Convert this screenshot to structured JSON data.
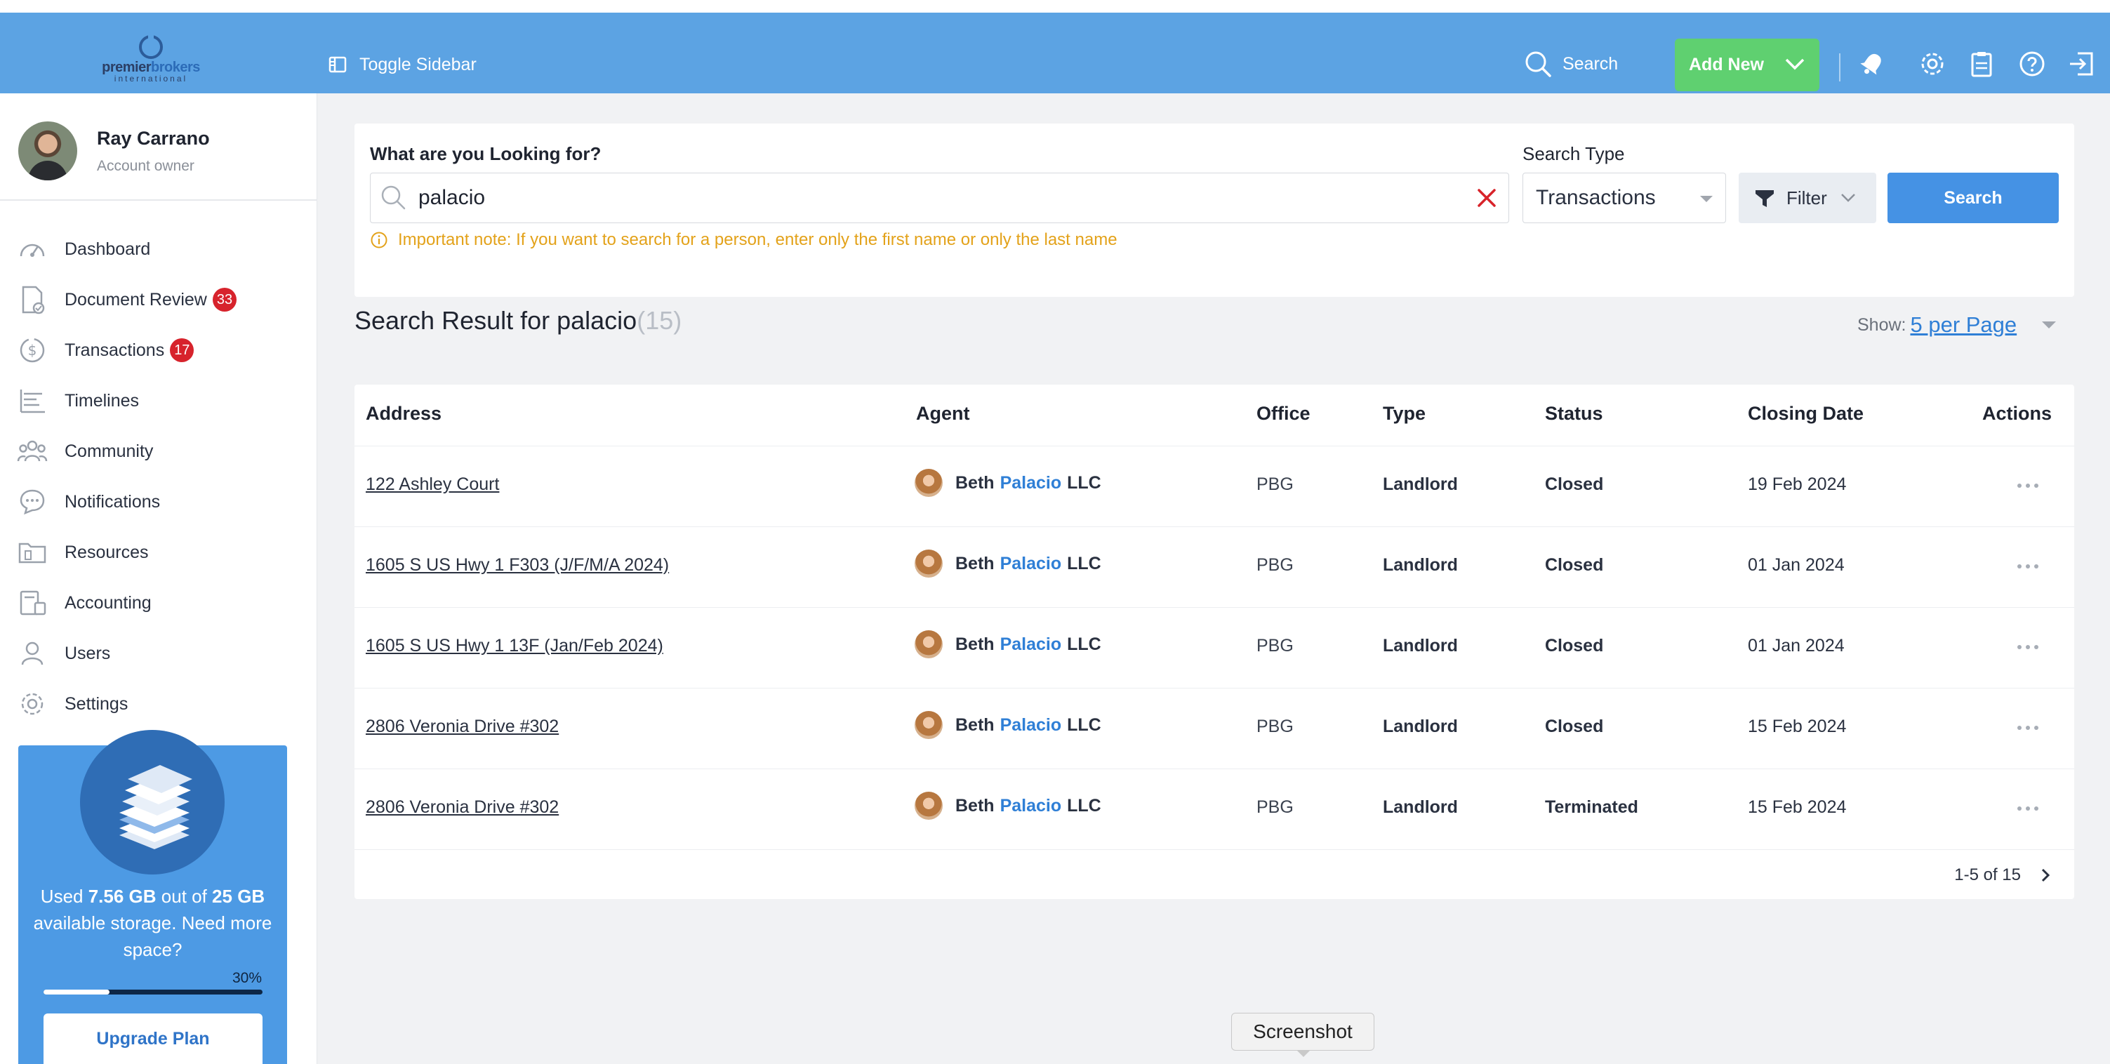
{
  "header": {
    "logo_text_a": "premier",
    "logo_text_b": "brokers",
    "logo_sub": "international",
    "toggle_label": "Toggle Sidebar",
    "search_label": "Search",
    "add_new_label": "Add New",
    "icons": [
      "bell-icon",
      "gear-icon",
      "clipboard-icon",
      "help-icon",
      "logout-icon"
    ]
  },
  "profile": {
    "name": "Ray Carrano",
    "role": "Account owner"
  },
  "sidebar": {
    "items": [
      {
        "label": "Dashboard",
        "icon": "gauge-icon"
      },
      {
        "label": "Document Review",
        "icon": "document-check-icon",
        "badge": "33"
      },
      {
        "label": "Transactions",
        "icon": "dollar-circle-icon",
        "badge": "17"
      },
      {
        "label": "Timelines",
        "icon": "timeline-icon"
      },
      {
        "label": "Community",
        "icon": "people-icon"
      },
      {
        "label": "Notifications",
        "icon": "chat-bubble-icon"
      },
      {
        "label": "Resources",
        "icon": "folder-icon"
      },
      {
        "label": "Accounting",
        "icon": "calculator-icon"
      },
      {
        "label": "Users",
        "icon": "user-icon"
      },
      {
        "label": "Settings",
        "icon": "gear-icon"
      }
    ]
  },
  "storage": {
    "used_prefix": "Used ",
    "used": "7.56 GB",
    "mid": " out of ",
    "total": "25 GB",
    "suffix": " available storage. Need more space?",
    "percent_label": "30%",
    "percent": 30,
    "upgrade_label": "Upgrade Plan"
  },
  "search": {
    "question_label": "What are you Looking for?",
    "query": "palacio",
    "type_label": "Search Type",
    "type_value": "Transactions",
    "filter_label": "Filter",
    "search_button": "Search",
    "note": "Important note: If you want to search for a person, enter only the first name or only the last name"
  },
  "results": {
    "title": "Search Result for palacio",
    "count": "(15)",
    "show_label": "Show:",
    "per_page": "5 per Page",
    "columns": [
      "Address",
      "Agent",
      "Office",
      "Type",
      "Status",
      "Closing Date",
      "Actions"
    ],
    "rows": [
      {
        "address": "122 Ashley Court",
        "agent_first": "Beth",
        "agent_match": "Palacio",
        "agent_last": "LLC",
        "office": "PBG",
        "type": "Landlord",
        "status": "Closed",
        "closing": "19 Feb 2024"
      },
      {
        "address": "1605 S US Hwy 1 F303 (J/F/M/A 2024)",
        "agent_first": "Beth",
        "agent_match": "Palacio",
        "agent_last": "LLC",
        "office": "PBG",
        "type": "Landlord",
        "status": "Closed",
        "closing": "01 Jan 2024"
      },
      {
        "address": "1605 S US Hwy 1 13F (Jan/Feb 2024)",
        "agent_first": "Beth",
        "agent_match": "Palacio",
        "agent_last": "LLC",
        "office": "PBG",
        "type": "Landlord",
        "status": "Closed",
        "closing": "01 Jan 2024"
      },
      {
        "address": "2806 Veronia Drive #302",
        "agent_first": "Beth",
        "agent_match": "Palacio",
        "agent_last": "LLC",
        "office": "PBG",
        "type": "Landlord",
        "status": "Closed",
        "closing": "15 Feb 2024"
      },
      {
        "address": "2806 Veronia Drive #302",
        "agent_first": "Beth",
        "agent_match": "Palacio",
        "agent_last": "LLC",
        "office": "PBG",
        "type": "Landlord",
        "status": "Terminated",
        "closing": "15 Feb 2024"
      }
    ],
    "pagination": "1-5 of 15"
  },
  "tooltip": "Screenshot",
  "colors": {
    "header": "#5ca3e3",
    "add_new": "#5fd070",
    "primary": "#4592e4",
    "badge": "#d7232c",
    "note": "#e3a21a",
    "link": "#2f7fd6"
  }
}
